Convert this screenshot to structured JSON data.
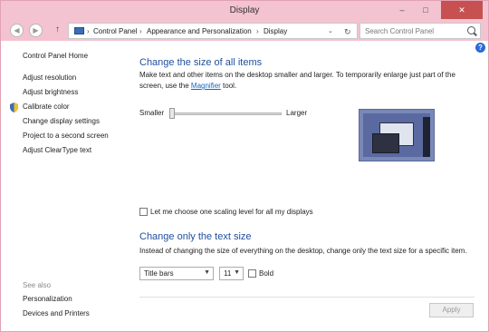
{
  "window": {
    "title": "Display"
  },
  "titlebar": {
    "minimize": "–",
    "maximize": "□",
    "close": "✕"
  },
  "address": {
    "up": "↑",
    "breadcrumbs": [
      "Control Panel",
      "Appearance and Personalization",
      "Display"
    ],
    "separator": "›",
    "dropdown": "⌄",
    "refresh": "↻"
  },
  "search": {
    "placeholder": "Search Control Panel"
  },
  "help": "?",
  "sidebar": {
    "home": "Control Panel Home",
    "items": [
      "Adjust resolution",
      "Adjust brightness",
      "Calibrate color",
      "Change display settings",
      "Project to a second screen",
      "Adjust ClearType text"
    ],
    "see_also": "See also",
    "see_also_items": [
      "Personalization",
      "Devices and Printers"
    ]
  },
  "size_section": {
    "heading": "Change the size of all items",
    "desc_before": "Make text and other items on the desktop smaller and larger. To temporarily enlarge just part of the screen, use the ",
    "link": "Magnifier",
    "desc_after": " tool.",
    "smaller": "Smaller",
    "larger": "Larger",
    "slider_position": 0
  },
  "scaling_checkbox": {
    "label": "Let me choose one scaling level for all my displays",
    "checked": false
  },
  "text_section": {
    "heading": "Change only the text size",
    "desc": "Instead of changing the size of everything on the desktop, change only the text size for a specific item.",
    "item_select": "Title bars",
    "size_select": "11",
    "bold_label": "Bold",
    "bold_checked": false
  },
  "apply": "Apply"
}
